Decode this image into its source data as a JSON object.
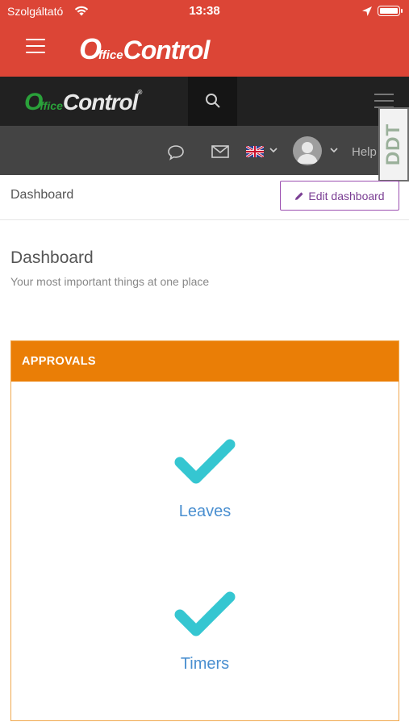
{
  "status_bar": {
    "carrier": "Szolgáltató",
    "time": "13:38"
  },
  "app_header": {
    "logo_prefix": "O",
    "logo_office": "ffice",
    "logo_control": "Control"
  },
  "site_nav": {
    "logo_prefix": "O",
    "logo_office": "ffice",
    "logo_control": "Control",
    "logo_reg": "®"
  },
  "toolbar": {
    "help_label": "Help",
    "badge_text": "DDT"
  },
  "page": {
    "breadcrumb": "Dashboard",
    "edit_button_label": "Edit dashboard",
    "title": "Dashboard",
    "subtitle": "Your most important things at one place"
  },
  "approvals": {
    "title": "APPROVALS",
    "items": [
      {
        "label": "Leaves"
      },
      {
        "label": "Timers"
      }
    ]
  },
  "colors": {
    "app_header": "#dc4536",
    "site_nav": "#212121",
    "toolbar": "#444444",
    "panel_header": "#ea7e06",
    "panel_border": "#f0a74d",
    "check": "#35c6d1",
    "link": "#4a8fd0",
    "edit_button": "#9b4fb0",
    "logo_green": "#2aa13a"
  },
  "icons": [
    "wifi-icon",
    "location-icon",
    "battery-icon",
    "menu-icon",
    "search-icon",
    "chat-icon",
    "mail-icon",
    "uk-flag-icon",
    "chevron-down-icon",
    "avatar",
    "pencil-icon",
    "check-icon"
  ]
}
